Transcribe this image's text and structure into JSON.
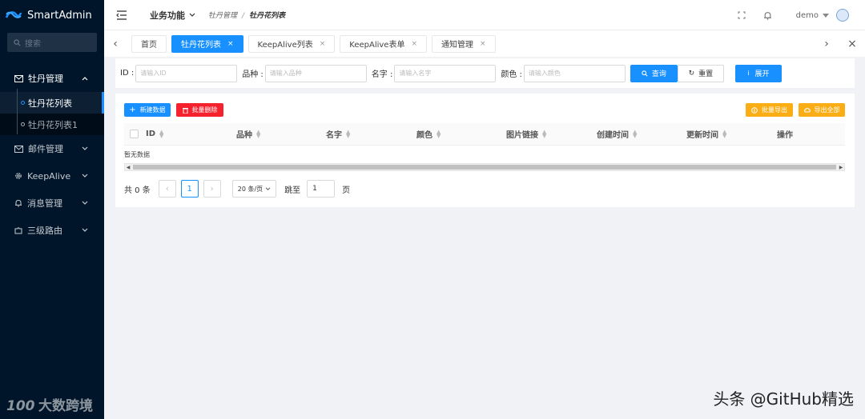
{
  "app": {
    "name": "SmartAdmin"
  },
  "sidebar": {
    "search_placeholder": "搜索",
    "menu": [
      {
        "label": "牡丹管理",
        "icon": "mail-icon",
        "open": true
      },
      {
        "label": "邮件管理",
        "icon": "mail-icon"
      },
      {
        "label": "KeepAlive",
        "icon": "gear-icon"
      },
      {
        "label": "消息管理",
        "icon": "bell-icon"
      },
      {
        "label": "三级路由",
        "icon": "puzzle-icon"
      }
    ],
    "submenu": [
      {
        "label": "牡丹花列表",
        "active": true
      },
      {
        "label": "牡丹花列表1",
        "active": false
      }
    ],
    "watermark": "大数跨境"
  },
  "header": {
    "business_menu": "业务功能",
    "breadcrumb": [
      "牡丹管理",
      "牡丹花列表"
    ],
    "user": "demo"
  },
  "tabs": [
    {
      "label": "首页",
      "closable": false,
      "active": false
    },
    {
      "label": "牡丹花列表",
      "closable": true,
      "active": true
    },
    {
      "label": "KeepAlive列表",
      "closable": true,
      "active": false
    },
    {
      "label": "KeepAlive表单",
      "closable": true,
      "active": false
    },
    {
      "label": "通知管理",
      "closable": true,
      "active": false
    }
  ],
  "filter": {
    "fields": [
      {
        "label": "ID :",
        "placeholder": "请输入ID"
      },
      {
        "label": "品种 :",
        "placeholder": "请输入品种"
      },
      {
        "label": "名字 :",
        "placeholder": "请输入名字"
      },
      {
        "label": "颜色 :",
        "placeholder": "请输入颜色"
      }
    ],
    "query_button": "查询",
    "reset_button": "重置",
    "expand_button": "展开"
  },
  "toolbar": {
    "create_button": "新建数据",
    "batch_delete_button": "批量删除",
    "batch_export_button": "批量导出",
    "export_all_button": "导出全部"
  },
  "table": {
    "columns": [
      "ID",
      "品种",
      "名字",
      "颜色",
      "图片链接",
      "创建时间",
      "更新时间",
      "操作"
    ],
    "empty_text": "暂无数据"
  },
  "pagination": {
    "total_text": "共 0 条",
    "current_page": "1",
    "page_size": "20 条/页",
    "jump_label": "跳至",
    "jump_value": "1",
    "page_suffix": "页"
  },
  "watermark_right": "头条 @GitHub精选",
  "colors": {
    "primary": "#1890ff",
    "danger": "#f5222d",
    "warning": "#faad14",
    "sidebar_bg": "#001529"
  }
}
